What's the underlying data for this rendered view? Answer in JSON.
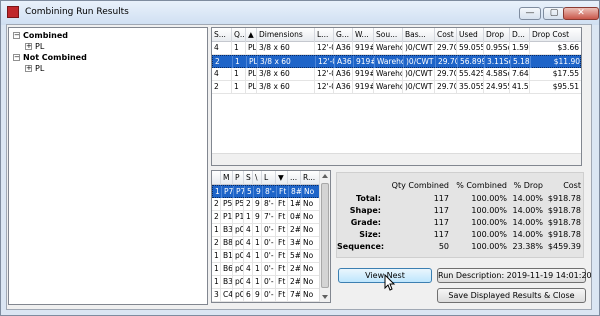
{
  "window": {
    "title": "Combining Run Results",
    "min": "—",
    "max": "▢",
    "close": "✕"
  },
  "tree": {
    "combined": {
      "label": "Combined",
      "child": "PL"
    },
    "not_combined": {
      "label": "Not Combined",
      "child": "PL"
    }
  },
  "top_grid": {
    "columns": [
      "S...",
      "Q...",
      "▲",
      "Dimensions",
      "L...",
      "G...",
      "W...",
      "Sou...",
      "Bas...",
      "Cost",
      "Used",
      "Drop",
      "D...",
      "Drop Cost"
    ],
    "rows": [
      [
        "4",
        "1",
        "PL",
        "3/8 x 60",
        "12'-0",
        "A36",
        "919#",
        "Wareho",
        ")0/CWT",
        "29.70",
        "59.055",
        "0.95Sc",
        "1.59",
        "$3.66"
      ],
      [
        "2",
        "1",
        "PL",
        "3/8 x 60",
        "12'-0",
        "A36",
        "919#",
        "Wareho",
        ")0/CWT",
        "29.70",
        "56.899",
        "3.11Sc",
        "5.18",
        "$11.90"
      ],
      [
        "4",
        "1",
        "PL",
        "3/8 x 60",
        "12'-0",
        "A36",
        "919#",
        "Wareho",
        ")0/CWT",
        "29.70",
        "55.425",
        "4.58Sc",
        "7.64",
        "$17.55"
      ],
      [
        "2",
        "1",
        "PL",
        "3/8 x 60",
        "12'-0",
        "A36",
        "919#",
        "Wareho",
        ")0/CWT",
        "29.70",
        "35.055",
        "24.955",
        "41.58",
        "$95.51"
      ]
    ],
    "selected_row": 1
  },
  "bottom_grid": {
    "columns": [
      "M",
      "P",
      "S",
      "\\",
      "L",
      "▼",
      "...",
      "R..."
    ],
    "rows": [
      [
        "1",
        "P7",
        "P7",
        "5",
        "9",
        "8'-",
        "Ft",
        "8#",
        "No"
      ],
      [
        "2",
        "P5",
        "P5",
        "2",
        "9",
        "8'-",
        "Ft",
        "1#",
        "No"
      ],
      [
        "2",
        "P1",
        "P1",
        "1",
        "9",
        "7'-",
        "Ft",
        "0#",
        "No"
      ],
      [
        "1",
        "B3",
        "p0",
        "4",
        "1",
        "0'-",
        "Ft",
        "2#",
        "No"
      ],
      [
        "2",
        "B8",
        "p0",
        "4",
        "1",
        "0'-",
        "Ft",
        "3#",
        "No"
      ],
      [
        "1",
        "B1",
        "p0",
        "4",
        "1",
        "0'-",
        "Ft",
        "5#",
        "No"
      ],
      [
        "1",
        "B6",
        "p0",
        "4",
        "1",
        "0'-",
        "Ft",
        "2#",
        "No"
      ],
      [
        "1",
        "B3",
        "p0",
        "4",
        "1",
        "0'-",
        "Ft",
        "2#",
        "No"
      ],
      [
        "3",
        "C4",
        "p0",
        "6",
        "9",
        "0'-",
        "Ft",
        "7#",
        "No"
      ]
    ]
  },
  "stats": {
    "headers": [
      "Qty Combined",
      "% Combined",
      "% Drop",
      "Cost"
    ],
    "rows": [
      [
        "Total:",
        "117",
        "100.00%",
        "14.00%",
        "$918.78"
      ],
      [
        "Shape:",
        "117",
        "100.00%",
        "14.00%",
        "$918.78"
      ],
      [
        "Grade:",
        "117",
        "100.00%",
        "14.00%",
        "$918.78"
      ],
      [
        "Size:",
        "117",
        "100.00%",
        "14.00%",
        "$918.78"
      ],
      [
        "Sequence:",
        "50",
        "100.00%",
        "23.38%",
        "$459.39"
      ]
    ]
  },
  "buttons": {
    "view_nest": "View Nest",
    "run_description": "Run Description: 2019-11-19 14:01:20",
    "save_close": "Save Displayed Results & Close"
  }
}
